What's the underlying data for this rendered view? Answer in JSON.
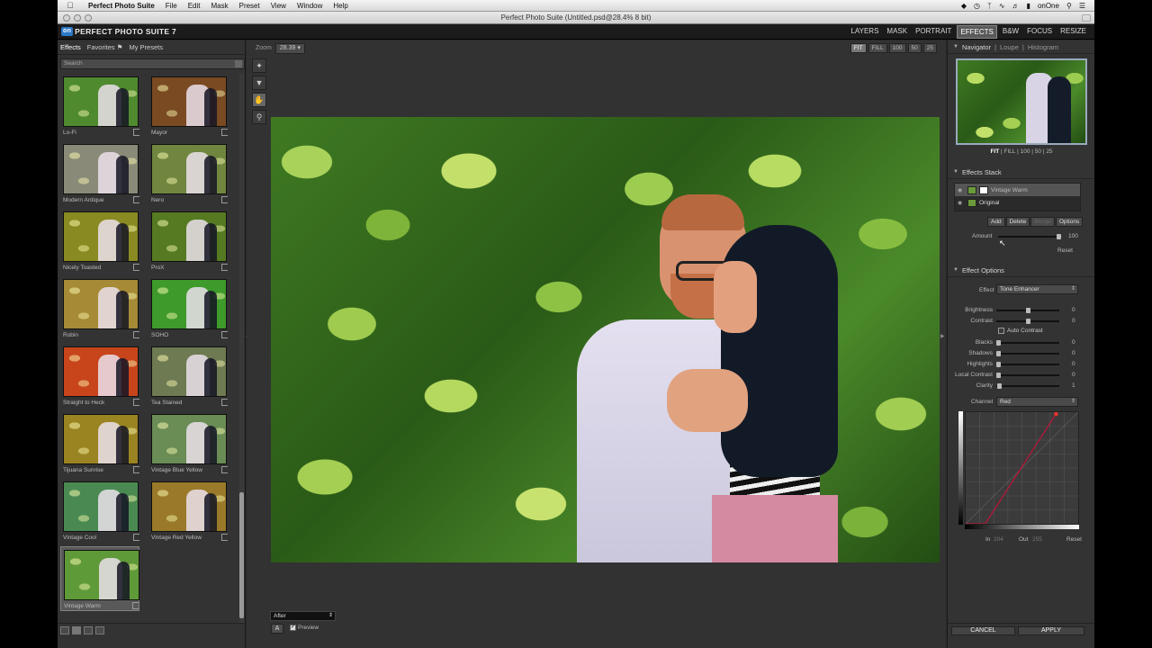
{
  "menubar": {
    "app": "Perfect Photo Suite",
    "items": [
      "File",
      "Edit",
      "Mask",
      "Preset",
      "View",
      "Window",
      "Help"
    ],
    "status_user": "onOne"
  },
  "window": {
    "title": "Perfect Photo Suite (Untitled.psd@28.4% 8 bit)"
  },
  "header": {
    "logo_mark": "on",
    "logo_text": "PERFECT PHOTO SUITE 7",
    "modules": [
      "LAYERS",
      "MASK",
      "PORTRAIT",
      "EFFECTS",
      "B&W",
      "FOCUS",
      "RESIZE"
    ],
    "active_module": "EFFECTS"
  },
  "left_panel": {
    "tabs": [
      "Effects",
      "Favorites",
      "My Presets"
    ],
    "search_placeholder": "Search",
    "presets": [
      {
        "name": "Lo-Fi",
        "tint": "#4f8a2f"
      },
      {
        "name": "Mayor",
        "tint": "#7a4a22"
      },
      {
        "name": "Modern Antique",
        "tint": "#8a8a78"
      },
      {
        "name": "Nero",
        "tint": "#70863f"
      },
      {
        "name": "Nicely Toasted",
        "tint": "#8a8a22"
      },
      {
        "name": "ProX",
        "tint": "#557a22"
      },
      {
        "name": "Robin",
        "tint": "#a68a35"
      },
      {
        "name": "SOHO",
        "tint": "#3e9a2a"
      },
      {
        "name": "Straight to Heck",
        "tint": "#c8451c"
      },
      {
        "name": "Tea Stained",
        "tint": "#6e7a52"
      },
      {
        "name": "Tijuana Sunrise",
        "tint": "#9a8422"
      },
      {
        "name": "Vintage Blue Yellow",
        "tint": "#6a8c55"
      },
      {
        "name": "Vintage Cool",
        "tint": "#4a8a52"
      },
      {
        "name": "Vintage Red Yellow",
        "tint": "#9a7a2a"
      },
      {
        "name": "Vintage Warm",
        "tint": "#5f9a38"
      }
    ],
    "selected_preset": "Vintage Warm"
  },
  "center": {
    "zoom_label": "Zoom",
    "zoom_value": "28.39",
    "fit_buttons": [
      "FIT",
      "FILL",
      "100",
      "50",
      "25"
    ],
    "view_mode": "After",
    "a_button": "A",
    "preview_label": "Preview",
    "preview_checked": true
  },
  "right_panel": {
    "navigator": {
      "tabs": [
        "Navigator",
        "Loupe",
        "Histogram"
      ],
      "zoom_options": [
        "FIT",
        "FILL",
        "100",
        "50",
        "25"
      ]
    },
    "effects_stack": {
      "title": "Effects Stack",
      "layers": [
        {
          "name": "Vintage Warm",
          "selected": true
        },
        {
          "name": "Original",
          "selected": false
        }
      ],
      "buttons": [
        "Add",
        "Delete",
        "Merge",
        "Options"
      ],
      "amount_label": "Amount",
      "amount_value": "100",
      "amount_fraction": 1.0,
      "reset_label": "Reset"
    },
    "effect_options": {
      "title": "Effect Options",
      "effect_label": "Effect",
      "effect_value": "Tone Enhancer",
      "sliders_top": [
        {
          "label": "Brightness",
          "value": "0",
          "pos": 0.5
        },
        {
          "label": "Contrast",
          "value": "0",
          "pos": 0.5
        }
      ],
      "auto_contrast_label": "Auto Contrast",
      "sliders_bottom": [
        {
          "label": "Blacks",
          "value": "0",
          "pos": 0.0
        },
        {
          "label": "Shadows",
          "value": "0",
          "pos": 0.0
        },
        {
          "label": "Highlights",
          "value": "0",
          "pos": 0.0
        },
        {
          "label": "Local Contrast",
          "value": "0",
          "pos": 0.0
        },
        {
          "label": "Clarity",
          "value": "1",
          "pos": 0.01
        }
      ],
      "channel_label": "Channel",
      "channel_value": "Red",
      "in_label": "In",
      "in_value": "204",
      "out_label": "Out",
      "out_value": "255",
      "curve_reset": "Reset"
    },
    "cancel_label": "CANCEL",
    "apply_label": "APPLY"
  }
}
